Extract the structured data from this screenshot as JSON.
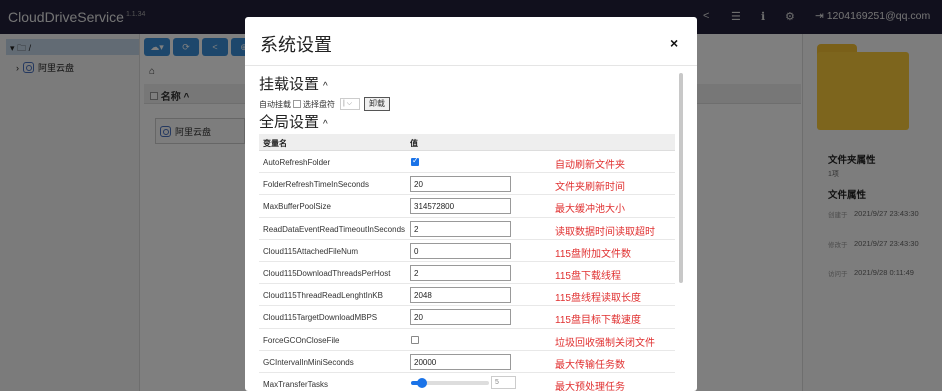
{
  "app": {
    "brand": "CloudDriveService",
    "version": "1.1.34",
    "user_email": "1204169251@qq.com",
    "nav_icons": [
      "share-icon",
      "list-icon",
      "info-icon",
      "gears-icon",
      "logout-icon"
    ]
  },
  "tree": {
    "root": "/",
    "items": [
      {
        "label": "阿里云盘"
      }
    ]
  },
  "main": {
    "column_name": "名称",
    "items": [
      {
        "label": "阿里云盘"
      }
    ]
  },
  "properties": {
    "folder_props_title": "文件夹属性",
    "folder_props_value": "1项",
    "file_props_title": "文件属性",
    "rows": [
      {
        "key": "创建于",
        "value": "2021/9/27 23:43:30"
      },
      {
        "key": "修改于",
        "value": "2021/9/27 23:43:30"
      },
      {
        "key": "访问于",
        "value": "2021/9/28 0:11:49"
      }
    ]
  },
  "modal": {
    "title": "系统设置",
    "close": "×",
    "mount_section": {
      "title": "挂载设置",
      "auto_mount": "自动挂载",
      "choose_drive": "选择盘符",
      "select_value": "|",
      "unmount_button": "卸载"
    },
    "global_section": {
      "title": "全局设置",
      "col_name": "变量名",
      "col_value": "值",
      "rows": [
        {
          "name": "AutoRefreshFolder",
          "type": "checkbox",
          "checked": true,
          "note": "自动刷新文件夹"
        },
        {
          "name": "FolderRefreshTimeInSeconds",
          "type": "text",
          "value": "20",
          "note": "文件夹刷新时间"
        },
        {
          "name": "MaxBufferPoolSize",
          "type": "text",
          "value": "314572800",
          "note": "最大缓冲池大小"
        },
        {
          "name": "ReadDataEventReadTimeoutInSeconds",
          "type": "text",
          "value": "2",
          "note": "读取数据时间读取超时"
        },
        {
          "name": "Cloud115AttachedFileNum",
          "type": "text",
          "value": "0",
          "note": "115盘附加文件数"
        },
        {
          "name": "Cloud115DownloadThreadsPerHost",
          "type": "text",
          "value": "2",
          "note": "115盘下载线程"
        },
        {
          "name": "Cloud115ThreadReadLenghtInKB",
          "type": "text",
          "value": "2048",
          "note": "115盘线程读取长度"
        },
        {
          "name": "Cloud115TargetDownloadMBPS",
          "type": "text",
          "value": "20",
          "note": "115盘目标下载速度"
        },
        {
          "name": "ForceGCOnCloseFile",
          "type": "checkbox",
          "checked": false,
          "note": "垃圾回收强制关闭文件"
        },
        {
          "name": "GCIntervalInMiniSeconds",
          "type": "text",
          "value": "20000",
          "note": "最大传输任务数"
        },
        {
          "name": "MaxTransferTasks",
          "type": "slider",
          "value": "5",
          "fraction": 0.12,
          "note": "最大预处理任务"
        }
      ]
    }
  },
  "colors": {
    "navbar": "#23213b",
    "accent": "#1a73e8",
    "note_red": "#e03030",
    "folder": "#fbca3a"
  }
}
